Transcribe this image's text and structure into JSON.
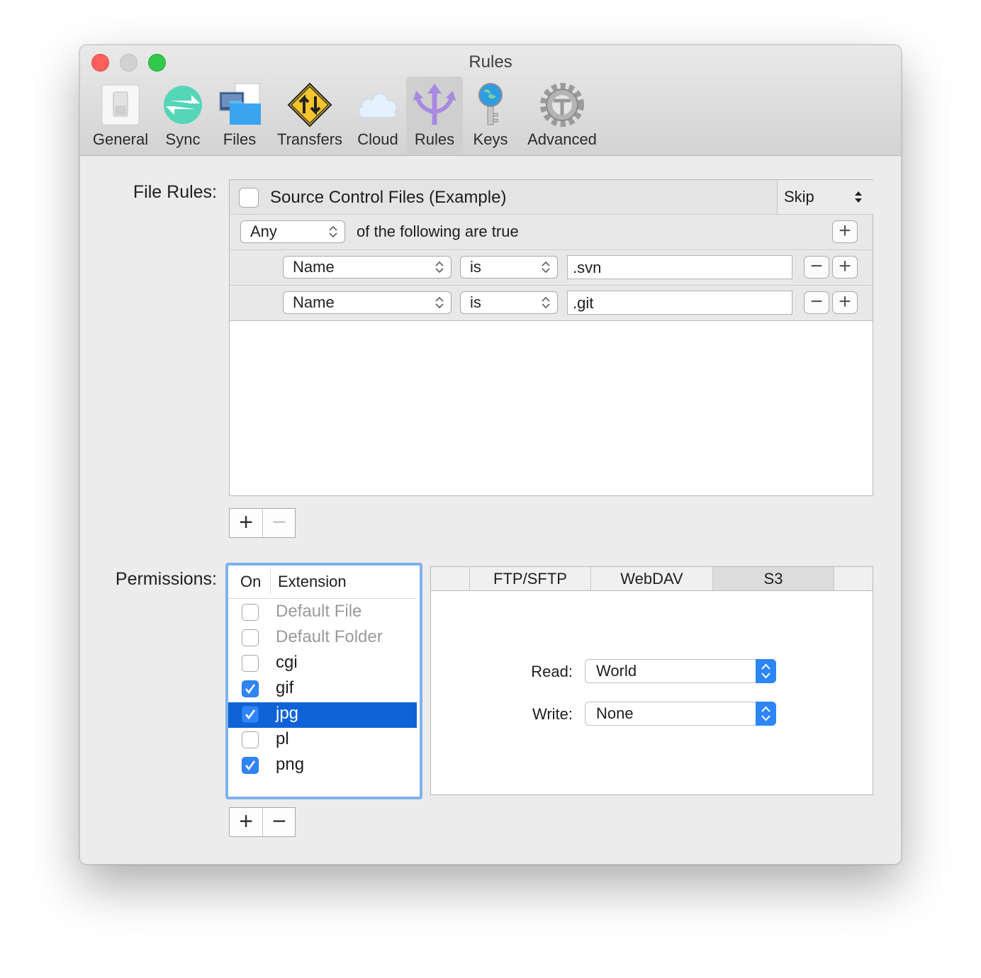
{
  "window": {
    "title": "Rules"
  },
  "toolbar": {
    "items": [
      {
        "label": "General",
        "icon": "light-switch-icon"
      },
      {
        "label": "Sync",
        "icon": "sync-arrows-icon"
      },
      {
        "label": "Files",
        "icon": "files-folder-icon"
      },
      {
        "label": "Transfers",
        "icon": "transfer-sign-icon"
      },
      {
        "label": "Cloud",
        "icon": "cloud-icon"
      },
      {
        "label": "Rules",
        "icon": "rules-arrows-icon",
        "selected": true
      },
      {
        "label": "Keys",
        "icon": "globe-key-icon"
      },
      {
        "label": "Advanced",
        "icon": "gear-icon"
      }
    ]
  },
  "file_rules": {
    "label": "File Rules:",
    "rule": {
      "enabled": false,
      "name": "Source Control Files (Example)",
      "action": "Skip"
    },
    "match": {
      "quantifier": "Any",
      "text": "of the following are true"
    },
    "conditions": [
      {
        "field": "Name",
        "operator": "is",
        "value": ".svn"
      },
      {
        "field": "Name",
        "operator": "is",
        "value": ".git"
      }
    ],
    "add_label": "+",
    "remove_label": "−"
  },
  "permissions": {
    "label": "Permissions:",
    "columns": {
      "on": "On",
      "extension": "Extension"
    },
    "rows": [
      {
        "on": false,
        "extension": "Default File",
        "dim": true
      },
      {
        "on": false,
        "extension": "Default Folder",
        "dim": true
      },
      {
        "on": false,
        "extension": "cgi"
      },
      {
        "on": true,
        "extension": "gif"
      },
      {
        "on": true,
        "extension": "jpg",
        "selected": true
      },
      {
        "on": false,
        "extension": "pl"
      },
      {
        "on": true,
        "extension": "png"
      }
    ],
    "add_label": "+",
    "remove_label": "−",
    "tabs": [
      "FTP/SFTP",
      "WebDAV",
      "S3"
    ],
    "selected_tab": "S3",
    "read_label": "Read:",
    "read_value": "World",
    "write_label": "Write:",
    "write_value": "None"
  },
  "colors": {
    "accent": "#0f63d6",
    "checkbox_on": "#2f84f6",
    "focus_ring": "#7fb1ef",
    "close": "#fc605c",
    "zoom": "#34c84a"
  }
}
